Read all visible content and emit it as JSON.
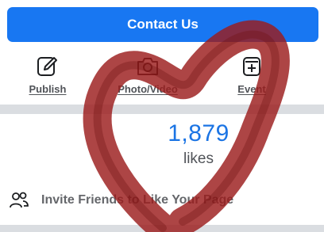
{
  "page": {
    "contact_button_label": "Contact Us",
    "actions": [
      {
        "label": "Publish",
        "icon": "edit-icon"
      },
      {
        "label": "Photo/Video",
        "icon": "camera-icon"
      },
      {
        "label": "Event",
        "icon": "event-icon"
      }
    ],
    "likes": {
      "count": "1,879",
      "label": "likes"
    },
    "invite_label": "Invite Friends to Like Your Page"
  },
  "colors": {
    "accent": "#1877f2",
    "likes_number": "#1b74e4",
    "divider": "#dadde1",
    "scribble": "#9b1c1c"
  }
}
